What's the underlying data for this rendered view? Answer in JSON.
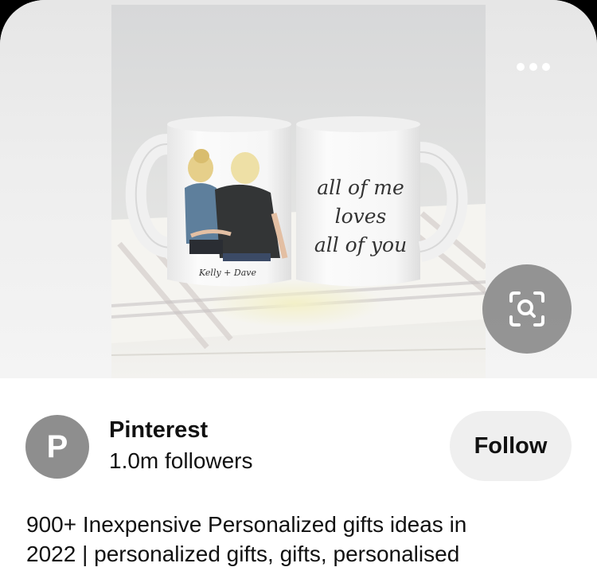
{
  "pin": {
    "image_alt": "Two white mugs: one printed with a couple illustration and names, the other with script text",
    "mug_names_text": "Kelly + Dave",
    "mug_script_lines": [
      "all of me",
      "loves",
      "all of you"
    ],
    "more_icon": "more-horizontal-icon",
    "visual_search_icon": "visual-search-icon"
  },
  "creator": {
    "avatar_initial": "P",
    "name": "Pinterest",
    "followers": "1.0m followers",
    "follow_label": "Follow"
  },
  "board": {
    "title_line1": "900+ Inexpensive Personalized gifts ideas in",
    "title_line2": "2022 | personalized gifts, gifts, personalised"
  },
  "colors": {
    "avatar_bg": "#8e8e8e",
    "follow_bg": "#efefef",
    "text": "#111111"
  }
}
